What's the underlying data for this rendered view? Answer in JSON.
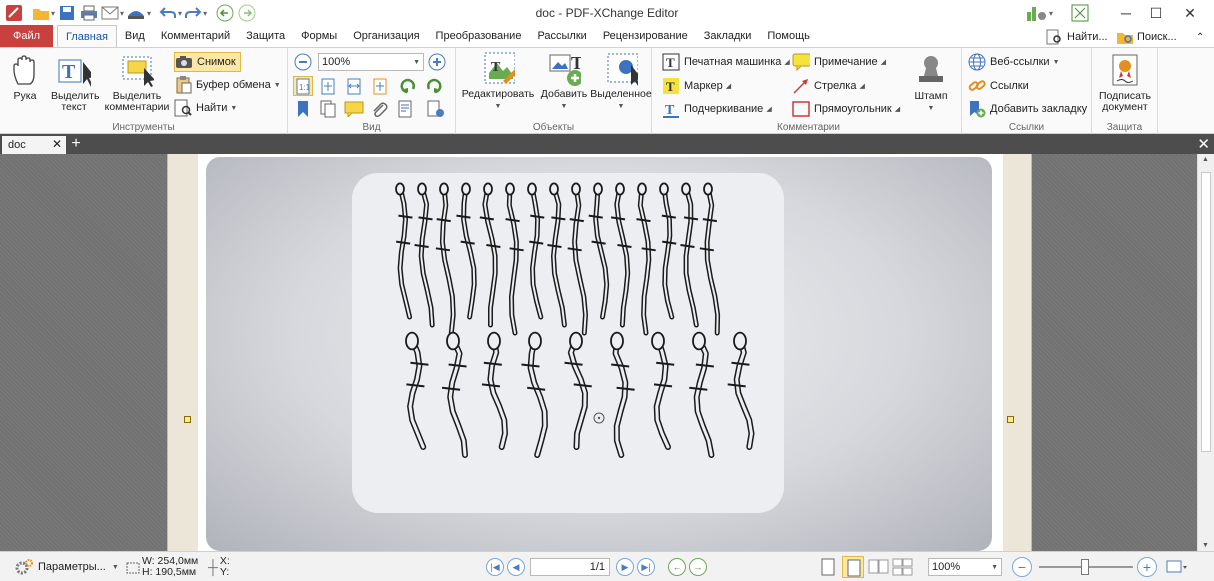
{
  "app": {
    "title": "doc - PDF-XChange Editor"
  },
  "tabs": {
    "file": "Файл",
    "items": [
      "Главная",
      "Вид",
      "Комментарий",
      "Защита",
      "Формы",
      "Организация",
      "Преобразование",
      "Рассылки",
      "Рецензирование",
      "Закладки",
      "Помощь"
    ],
    "find": "Найти...",
    "search": "Поиск..."
  },
  "ribbon": {
    "tools": {
      "hand": "Рука",
      "select_text": "Выделить текст",
      "select_comments": "Выделить комментарии",
      "snapshot": "Снимок",
      "clipboard": "Буфер обмена",
      "find": "Найти",
      "label": "Инструменты"
    },
    "view": {
      "zoom": "100%",
      "label": "Вид"
    },
    "objects": {
      "edit": "Редактировать",
      "add": "Добавить",
      "selected": "Выделенное",
      "label": "Объекты"
    },
    "comments": {
      "typewriter": "Печатная машинка",
      "marker": "Маркер",
      "underline": "Подчеркивание",
      "note": "Примечание",
      "arrow": "Стрелка",
      "rectangle": "Прямоугольник",
      "stamp": "Штамп",
      "label": "Комментарии"
    },
    "links": {
      "web_links": "Веб-ссылки",
      "links": "Ссылки",
      "add_bookmark": "Добавить закладку",
      "label": "Ссылки"
    },
    "protect": {
      "sign": "Подписать документ",
      "label": "Защита"
    }
  },
  "doc_tab": {
    "name": "doc"
  },
  "status": {
    "options": "Параметры...",
    "width": "W: 254,0мм",
    "height": "H: 190,5мм",
    "x": "X:",
    "y": "Y:",
    "page": "1/1",
    "zoom": "100%"
  },
  "colors": {
    "file_tab": "#c8413e",
    "accent": "#1a56a8",
    "snapshot_bg": "#fde7a4"
  }
}
